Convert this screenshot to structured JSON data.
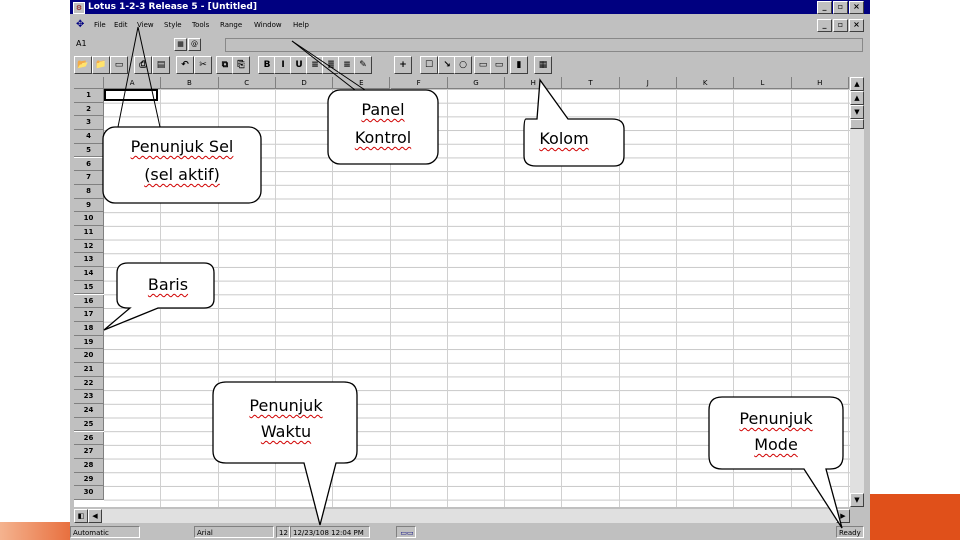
{
  "window": {
    "title": "Lotus 1-2-3 Release 5 - [Untitled]",
    "title_buttons": [
      "_",
      "▫",
      "×"
    ],
    "doc_buttons": [
      "_",
      "▫",
      "×"
    ]
  },
  "menu": [
    "File",
    "Edit",
    "View",
    "Style",
    "Tools",
    "Range",
    "Window",
    "Help"
  ],
  "editline": {
    "cell_ref": "A1"
  },
  "toolbar_icons": [
    {
      "name": "open-icon",
      "g": "📂"
    },
    {
      "name": "open-file-icon",
      "g": "📁"
    },
    {
      "name": "save-icon",
      "g": "▭"
    },
    {
      "name": "print-icon",
      "g": "⎙"
    },
    {
      "name": "preview-icon",
      "g": "▤"
    },
    {
      "name": "undo-icon",
      "g": "↶"
    },
    {
      "name": "cut-icon",
      "g": "✂"
    },
    {
      "name": "copy-icon",
      "g": "⧉"
    },
    {
      "name": "paste-icon",
      "g": "⎘"
    },
    {
      "name": "bold-icon",
      "g": "B"
    },
    {
      "name": "italic-icon",
      "g": "I"
    },
    {
      "name": "underline-icon",
      "g": "U"
    },
    {
      "name": "align-left-icon",
      "g": "≡"
    },
    {
      "name": "align-center-icon",
      "g": "≣"
    },
    {
      "name": "align-right-icon",
      "g": "≡"
    },
    {
      "name": "style-icon",
      "g": "✎"
    },
    {
      "name": "sum-icon",
      "g": "+"
    },
    {
      "name": "box-icon",
      "g": "☐"
    },
    {
      "name": "arrow-icon",
      "g": "↘"
    },
    {
      "name": "ellipse-icon",
      "g": "○"
    },
    {
      "name": "button-icon",
      "g": "▭"
    },
    {
      "name": "text-icon",
      "g": "▭"
    },
    {
      "name": "chart-icon",
      "g": "▮"
    },
    {
      "name": "smarticon-icon",
      "g": "▦"
    }
  ],
  "grid": {
    "columns": [
      "A",
      "B",
      "C",
      "D",
      "E",
      "F",
      "G",
      "H",
      "T",
      "J",
      "K",
      "L",
      "H"
    ],
    "rows": [
      "1",
      "2",
      "3",
      "4",
      "5",
      "6",
      "7",
      "8",
      "9",
      "10",
      "11",
      "12",
      "13",
      "14",
      "15",
      "16",
      "17",
      "18",
      "19",
      "20",
      "21",
      "22",
      "23",
      "24",
      "25",
      "26",
      "27",
      "28",
      "29",
      "30"
    ]
  },
  "statusbar": {
    "automatic": "Automatic",
    "font": "Arial",
    "size": "12",
    "datetime": "12/23/108 12:04 PM",
    "mode": "Ready"
  },
  "callouts": {
    "penunjuk_sel": [
      "Penunjuk Sel",
      "(sel aktif)"
    ],
    "panel_kontrol": [
      "Panel",
      "Kontrol"
    ],
    "kolom": [
      "Kolom"
    ],
    "baris": [
      "Baris"
    ],
    "penunjuk_waktu": [
      "Penunjuk",
      "Waktu"
    ],
    "penunjuk_mode": [
      "Penunjuk",
      "Mode"
    ]
  },
  "colors": {
    "titlebar": "#000080",
    "chrome": "#c0c0c0",
    "accent_orange": "#e0501a"
  }
}
